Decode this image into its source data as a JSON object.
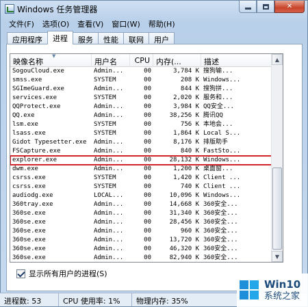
{
  "window": {
    "title": "Windows 任务管理器"
  },
  "caption_buttons": {
    "minimize": "",
    "maximize": "",
    "close": "✕"
  },
  "menu": [
    "文件(F)",
    "选项(O)",
    "查看(V)",
    "窗口(W)",
    "帮助(H)"
  ],
  "tabs": [
    "应用程序",
    "进程",
    "服务",
    "性能",
    "联网",
    "用户"
  ],
  "active_tab": "进程",
  "columns": [
    "映像名称",
    "用户名",
    "CPU",
    "内存(...",
    "描述"
  ],
  "processes": [
    {
      "name": "SogouCloud.exe",
      "user": "Admin...",
      "cpu": "00",
      "mem": "3,784 K",
      "desc": "搜狗输..."
    },
    {
      "name": "smss.exe",
      "user": "SYSTEM",
      "cpu": "00",
      "mem": "208 K",
      "desc": "Windows..."
    },
    {
      "name": "SGImeGuard.exe",
      "user": "Admin...",
      "cpu": "00",
      "mem": "844 K",
      "desc": "搜狗拼..."
    },
    {
      "name": "services.exe",
      "user": "SYSTEM",
      "cpu": "00",
      "mem": "2,020 K",
      "desc": "服务和..."
    },
    {
      "name": "QQProtect.exe",
      "user": "Admin...",
      "cpu": "00",
      "mem": "3,984 K",
      "desc": "QQ安全..."
    },
    {
      "name": "QQ.exe",
      "user": "Admin...",
      "cpu": "00",
      "mem": "38,256 K",
      "desc": "腾讯QQ"
    },
    {
      "name": "lsm.exe",
      "user": "SYSTEM",
      "cpu": "00",
      "mem": "756 K",
      "desc": "本地会..."
    },
    {
      "name": "lsass.exe",
      "user": "SYSTEM",
      "cpu": "00",
      "mem": "1,864 K",
      "desc": "Local S..."
    },
    {
      "name": "Gidot Typesetter.exe",
      "user": "Admin...",
      "cpu": "00",
      "mem": "8,176 K",
      "desc": "排版助手"
    },
    {
      "name": "FSCapture.exe",
      "user": "Admin...",
      "cpu": "00",
      "mem": "840 K",
      "desc": "FastSto..."
    },
    {
      "name": "explorer.exe",
      "user": "Admin...",
      "cpu": "00",
      "mem": "28,132 K",
      "desc": "Windows..."
    },
    {
      "name": "dwm.exe",
      "user": "Admin...",
      "cpu": "00",
      "mem": "1,200 K",
      "desc": "桌面窗..."
    },
    {
      "name": "csrss.exe",
      "user": "SYSTEM",
      "cpu": "00",
      "mem": "1,420 K",
      "desc": "Client ..."
    },
    {
      "name": "csrss.exe",
      "user": "SYSTEM",
      "cpu": "00",
      "mem": "740 K",
      "desc": "Client ..."
    },
    {
      "name": "audiodg.exe",
      "user": "LOCAL...",
      "cpu": "00",
      "mem": "10,096 K",
      "desc": "Windows..."
    },
    {
      "name": "360tray.exe",
      "user": "Admin...",
      "cpu": "00",
      "mem": "14,668 K",
      "desc": "360安全..."
    },
    {
      "name": "360se.exe",
      "user": "Admin...",
      "cpu": "00",
      "mem": "31,340 K",
      "desc": "360安全..."
    },
    {
      "name": "360se.exe",
      "user": "Admin...",
      "cpu": "00",
      "mem": "28,456 K",
      "desc": "360安全..."
    },
    {
      "name": "360se.exe",
      "user": "Admin...",
      "cpu": "00",
      "mem": "960 K",
      "desc": "360安全..."
    },
    {
      "name": "360se.exe",
      "user": "Admin...",
      "cpu": "00",
      "mem": "13,720 K",
      "desc": "360安全..."
    },
    {
      "name": "360se.exe",
      "user": "Admin...",
      "cpu": "00",
      "mem": "46,320 K",
      "desc": "360安全..."
    },
    {
      "name": "360se.exe",
      "user": "Admin...",
      "cpu": "00",
      "mem": "82,940 K",
      "desc": "360安全..."
    }
  ],
  "selected_process": "explorer.exe",
  "show_all_users": {
    "label": "显示所有用户的进程(S)",
    "checked": true
  },
  "status": {
    "processes": "进程数: 53",
    "cpu": "CPU 使用率: 1%",
    "memory": "物理内存: 35%"
  },
  "watermark": {
    "line1": "Win10",
    "line2": "系统之家"
  },
  "colors": {
    "selection_outline": "#d1232a",
    "window_frame": "#c9dcef"
  },
  "icons": {
    "app": "task-manager-icon",
    "sort": "sort-indicator-icon",
    "check": "checkmark-icon",
    "logo": "windows-logo-icon"
  }
}
